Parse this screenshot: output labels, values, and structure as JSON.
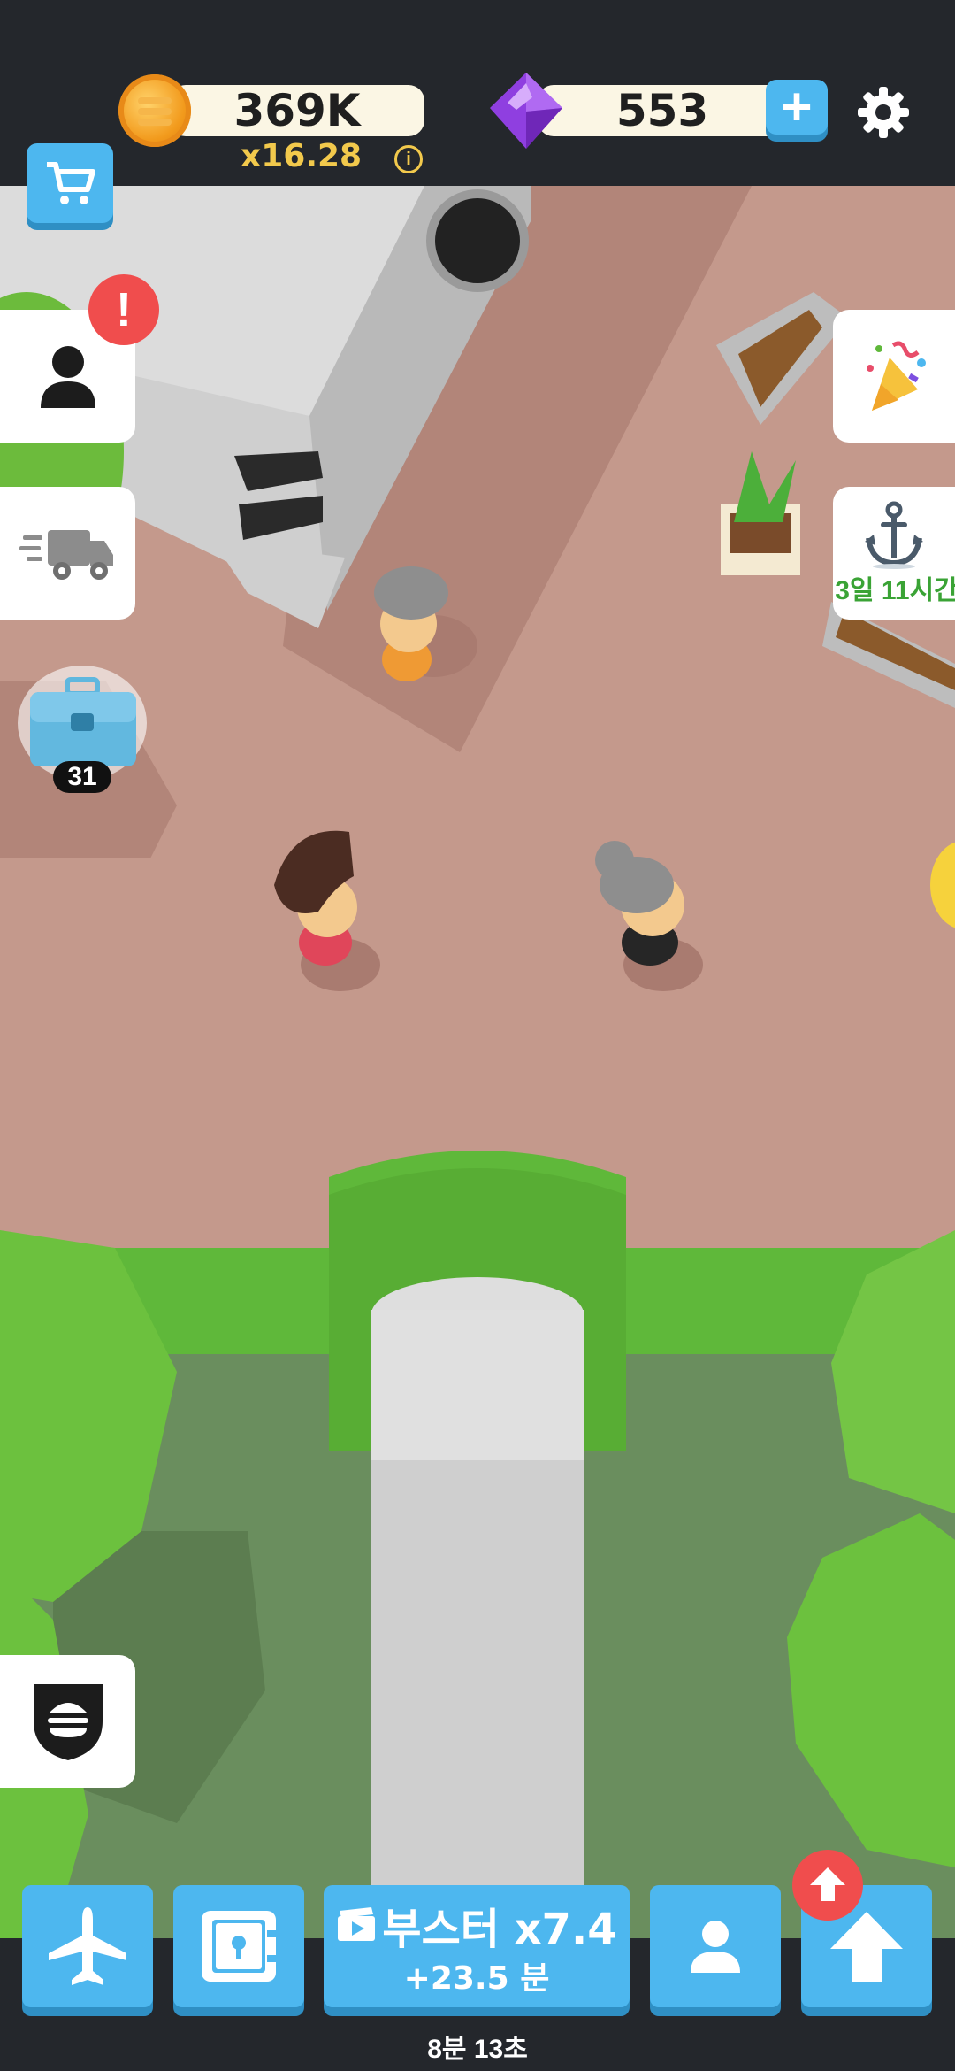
{
  "currency": {
    "coins": "369K",
    "multiplier": "x16.28",
    "info": "i",
    "gems": "553",
    "add": "+"
  },
  "side_panels": {
    "alert": "!",
    "crate_count": "31",
    "event_timer": "3일 11시간"
  },
  "bottom": {
    "booster_label": "부스터 x7.4",
    "booster_time": "+23.5 분",
    "timer": "8분 13초"
  },
  "colors": {
    "accent_blue": "#4db7ef",
    "alert_red": "#f04d4d",
    "gold": "#f2c94c",
    "floor": "#c4998c",
    "grass": "#5fb83a"
  }
}
